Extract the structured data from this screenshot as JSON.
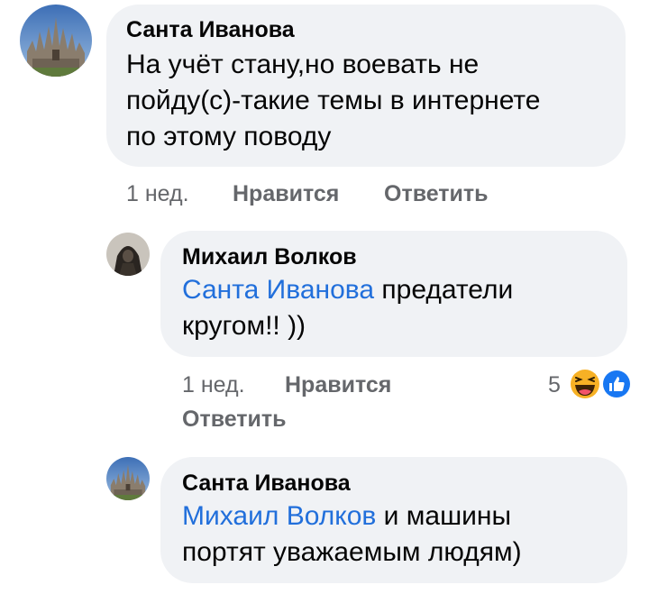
{
  "comments": [
    {
      "author": "Санта Иванова",
      "mention": "",
      "text_lines": [
        "На учёт стану,но воевать не",
        "пойду(с)-такие темы в интернете",
        "по этому поводу"
      ],
      "time": "1 нед.",
      "like_label": "Нравится",
      "reply_label": "Ответить",
      "avatar_icon": "castle-avatar"
    },
    {
      "author": "Михаил Волков",
      "mention": "Санта Иванова",
      "text_after_mention": " предатели",
      "text_line2": "кругом!! ))",
      "time": "1 нед.",
      "like_label": "Нравится",
      "reply_label": "Ответить",
      "reaction_count": "5",
      "reaction_icons": [
        "haha-icon",
        "like-icon"
      ],
      "avatar_icon": "hooded-figure-avatar"
    },
    {
      "author": "Санта Иванова",
      "mention": "Михаил Волков",
      "text_after_mention": " и машины",
      "text_line2": "портят уважаемым людям)",
      "avatar_icon": "castle-avatar"
    }
  ],
  "colors": {
    "bubble": "#f0f2f5",
    "mention": "#216fdb",
    "meta": "#65676b",
    "haha": "#f7b125",
    "like": "#1877f2"
  }
}
